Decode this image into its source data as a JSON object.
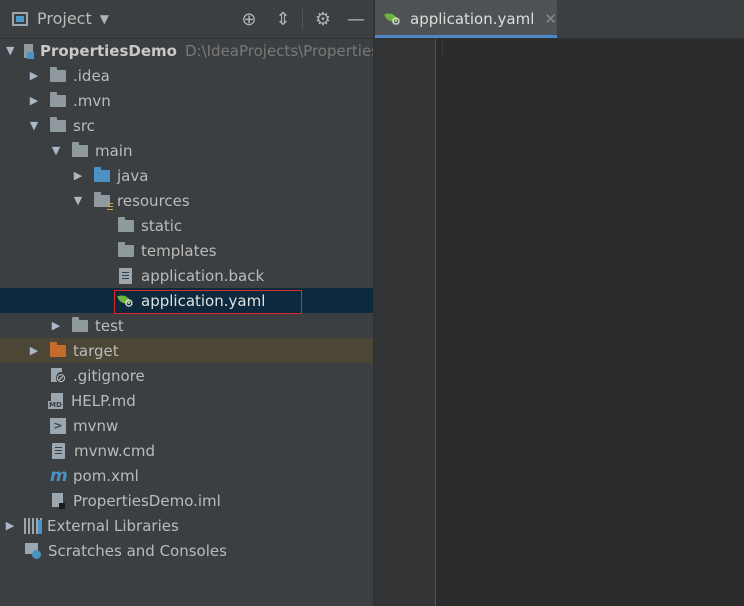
{
  "project_panel": {
    "title": "Project",
    "dropdown_icon": "caret-down-icon",
    "toolbar": [
      "locate-icon",
      "collapse-icon",
      "gear-icon",
      "minimize-icon"
    ]
  },
  "tree": [
    {
      "label": "PropertiesDemo",
      "path": "D:\\IdeaProjects\\Properties",
      "icon": "module-icon",
      "expanded": true
    },
    {
      "label": ".idea",
      "icon": "folder-icon",
      "expanded": false
    },
    {
      "label": ".mvn",
      "icon": "folder-icon",
      "expanded": false
    },
    {
      "label": "src",
      "icon": "folder-icon",
      "expanded": true
    },
    {
      "label": "main",
      "icon": "folder-icon",
      "expanded": true
    },
    {
      "label": "java",
      "icon": "source-folder-icon",
      "expanded": false
    },
    {
      "label": "resources",
      "icon": "resources-folder-icon",
      "expanded": true
    },
    {
      "label": "static",
      "icon": "folder-icon"
    },
    {
      "label": "templates",
      "icon": "folder-icon"
    },
    {
      "label": "application.back",
      "icon": "text-file-icon"
    },
    {
      "label": "application.yaml",
      "icon": "spring-config-icon",
      "selected": true
    },
    {
      "label": "test",
      "icon": "folder-icon",
      "expanded": false
    },
    {
      "label": "target",
      "icon": "excluded-folder-icon",
      "expanded": false
    },
    {
      "label": ".gitignore",
      "icon": "gitignore-icon"
    },
    {
      "label": "HELP.md",
      "icon": "markdown-icon"
    },
    {
      "label": "mvnw",
      "icon": "shell-icon"
    },
    {
      "label": "mvnw.cmd",
      "icon": "text-file-icon"
    },
    {
      "label": "pom.xml",
      "icon": "maven-icon"
    },
    {
      "label": "PropertiesDemo.iml",
      "icon": "iml-file-icon"
    },
    {
      "label": "External Libraries",
      "icon": "libraries-icon",
      "expanded": false
    },
    {
      "label": "Scratches and Consoles",
      "icon": "scratches-icon"
    }
  ],
  "editor": {
    "active_tab": "application.yaml",
    "tab_close_icon": "close-icon"
  },
  "colors": {
    "panel_bg": "#3c3f41",
    "editor_bg": "#2b2b2b",
    "selection_bg": "#0d293e",
    "excluded_bg": "#4c4637",
    "highlight_border": "#e02a2a",
    "tab_underline": "#4a88c7"
  }
}
